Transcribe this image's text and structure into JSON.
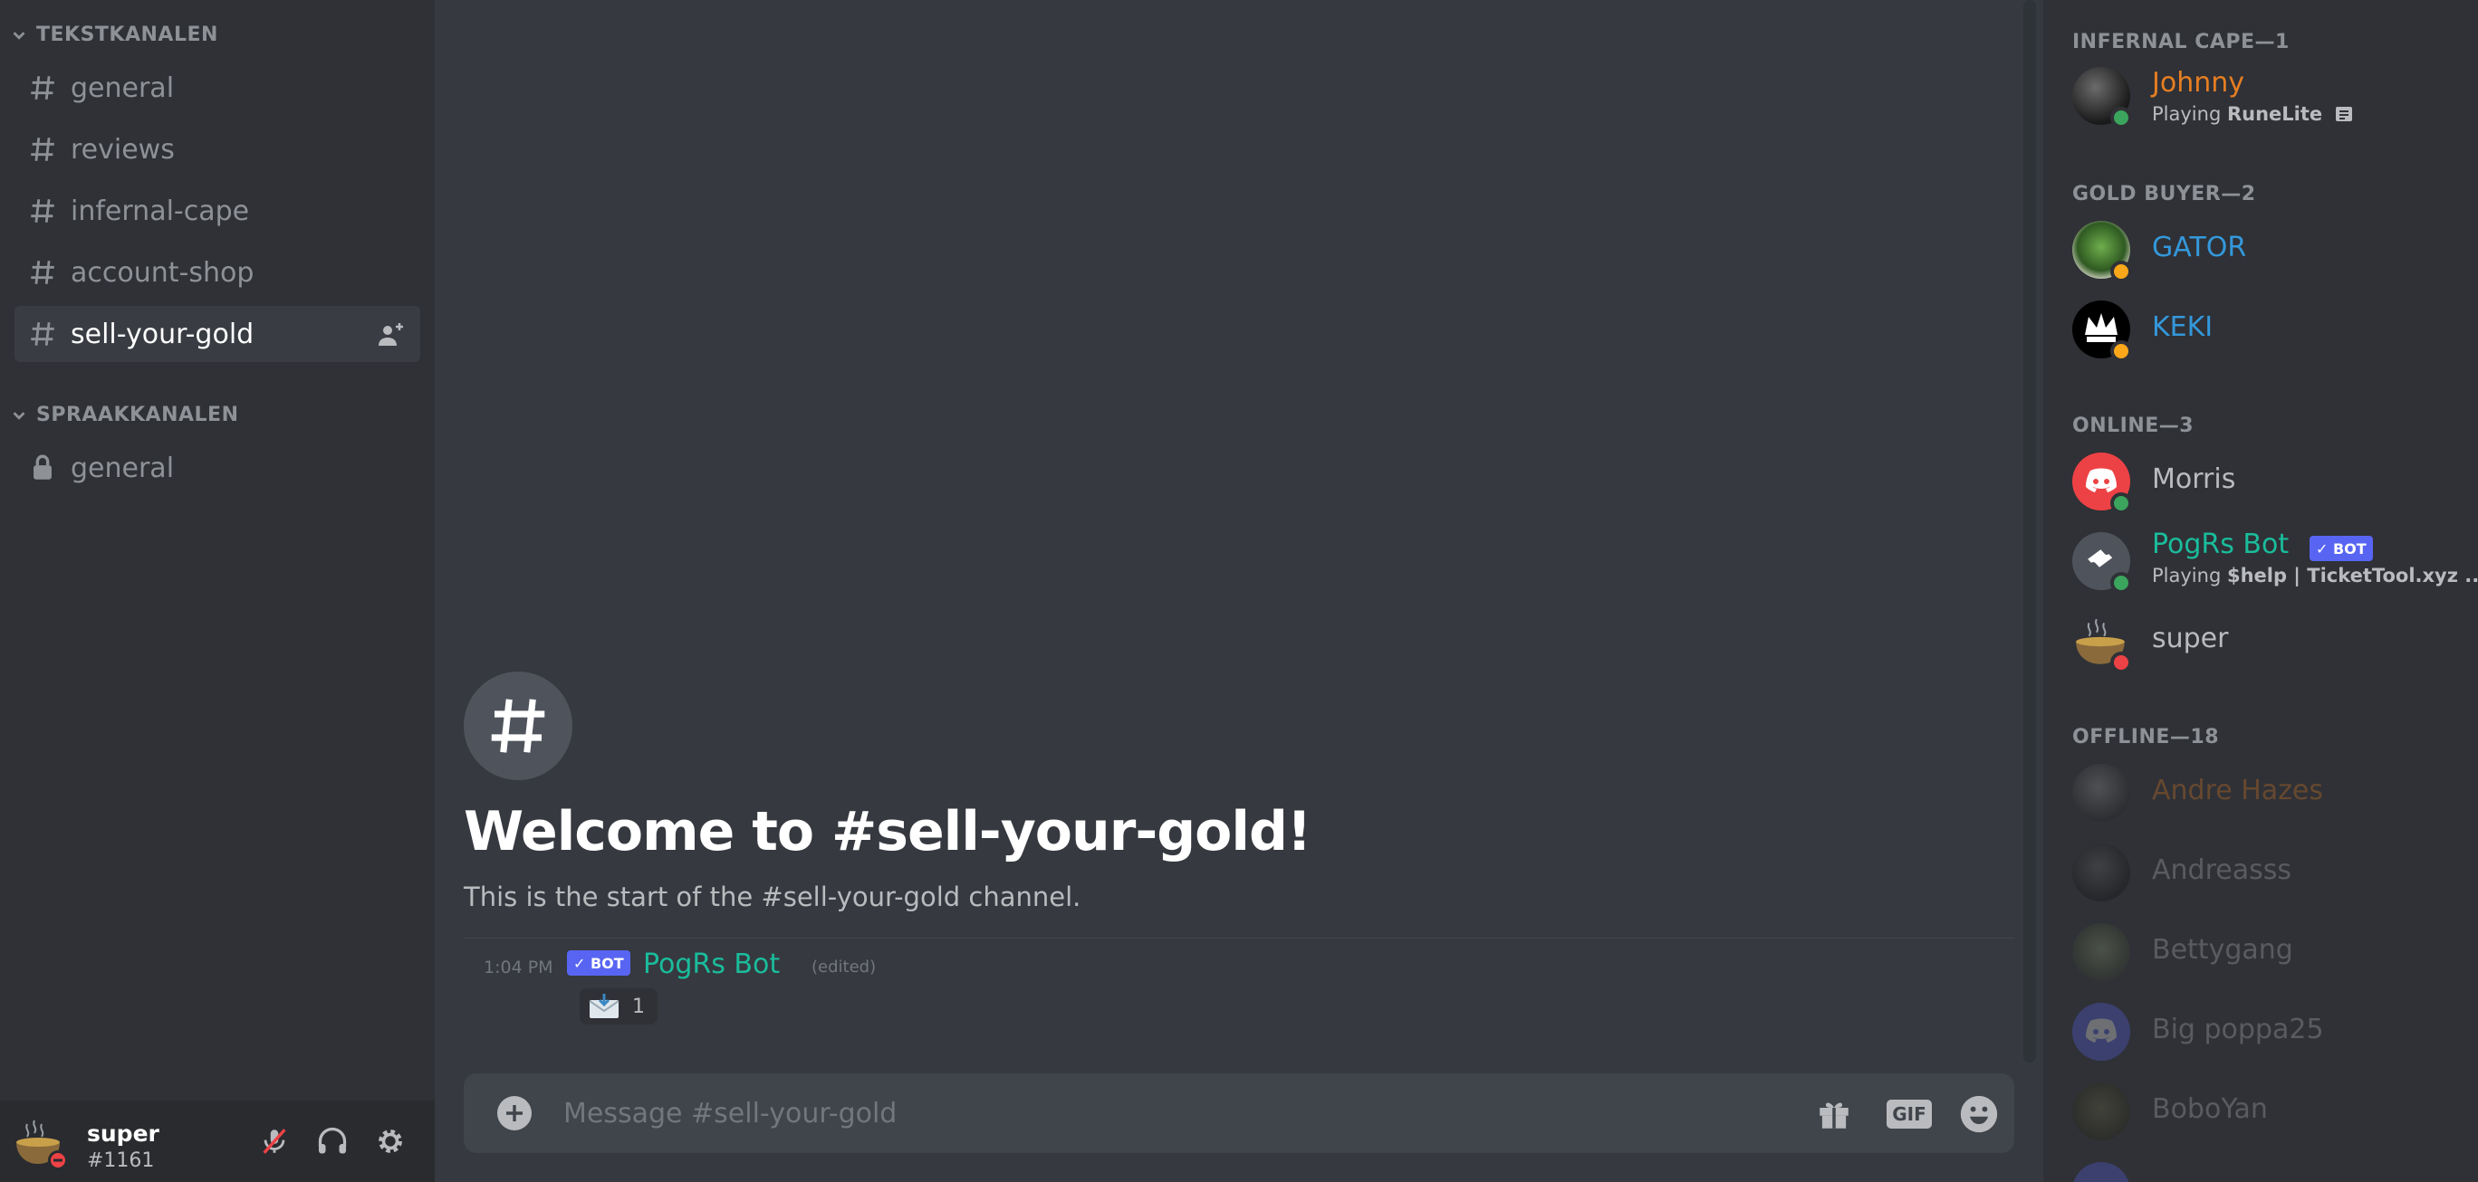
{
  "sidebar": {
    "text_category": "TEKSTKANALEN",
    "text_channels": [
      "general",
      "reviews",
      "infernal-cape",
      "account-shop",
      "sell-your-gold"
    ],
    "voice_category": "SPRAAKKANALEN",
    "voice_channels": [
      "general"
    ]
  },
  "user": {
    "name": "super",
    "tag": "#1161"
  },
  "chat": {
    "welcome_title": "Welcome to #sell-your-gold!",
    "welcome_sub": "This is the start of the #sell-your-gold channel.",
    "message": {
      "time": "1:04 PM",
      "badge": "✓ BOT",
      "author": "PogRs Bot",
      "edited": "(edited)",
      "reaction_count": "1"
    },
    "composer_placeholder": "Message #sell-your-gold",
    "gif_label": "GIF"
  },
  "members": {
    "groups": [
      {
        "header": "INFERNAL CAPE—1"
      },
      {
        "header": "GOLD BUYER—2"
      },
      {
        "header": "ONLINE—3"
      },
      {
        "header": "OFFLINE—18"
      }
    ],
    "johnny": {
      "name": "Johnny",
      "activity_prefix": "Playing ",
      "activity": "RuneLite",
      "color": "#e67e22"
    },
    "gator": {
      "name": "GATOR",
      "color": "#3498db"
    },
    "keki": {
      "name": "KEKI",
      "color": "#3498db"
    },
    "morris": {
      "name": "Morris"
    },
    "pogrs": {
      "name": "PogRs Bot",
      "badge": "✓ BOT",
      "activity_prefix": "Playing ",
      "activity": "$help | TicketTool.xyz ...",
      "color": "#1abc9c"
    },
    "super": {
      "name": "super"
    },
    "offline": [
      "Andre Hazes",
      "Andreasss",
      "Bettygang",
      "Big poppa25",
      "BoboYan"
    ]
  },
  "colors": {
    "online": "#3ba55d",
    "idle": "#faa81a",
    "dnd": "#ed4245",
    "blurple": "#5865f2"
  }
}
